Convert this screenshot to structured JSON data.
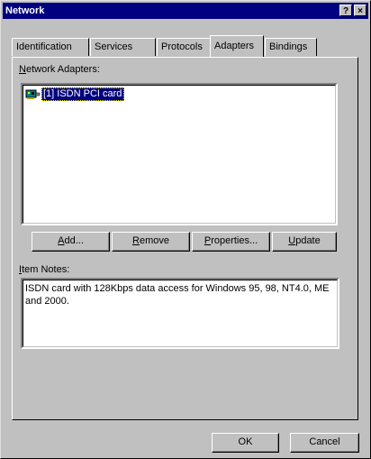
{
  "window": {
    "title": "Network"
  },
  "titlebar_buttons": {
    "help": "?",
    "close": "×"
  },
  "tabs": [
    {
      "label": "Identification"
    },
    {
      "label": "Services"
    },
    {
      "label": "Protocols"
    },
    {
      "label": "Adapters",
      "selected": true
    },
    {
      "label": "Bindings"
    }
  ],
  "adapters": {
    "list_label_first": "N",
    "list_label_rest": "etwork Adapters:",
    "items": [
      {
        "label": "[1] ISDN PCI card",
        "icon": "network-adapter-icon",
        "selected": true
      }
    ]
  },
  "buttons": {
    "add": {
      "u": "A",
      "rest": "dd..."
    },
    "remove": {
      "u": "R",
      "rest": "emove"
    },
    "properties": {
      "u": "P",
      "rest": "roperties..."
    },
    "update": {
      "u": "U",
      "rest": "pdate"
    }
  },
  "item_notes": {
    "label_first": "I",
    "label_rest": "tem Notes:",
    "text": "ISDN card with 128Kbps data access for Windows 95, 98, NT4.0, ME and 2000."
  },
  "dialog_buttons": {
    "ok": "OK",
    "cancel": "Cancel"
  }
}
